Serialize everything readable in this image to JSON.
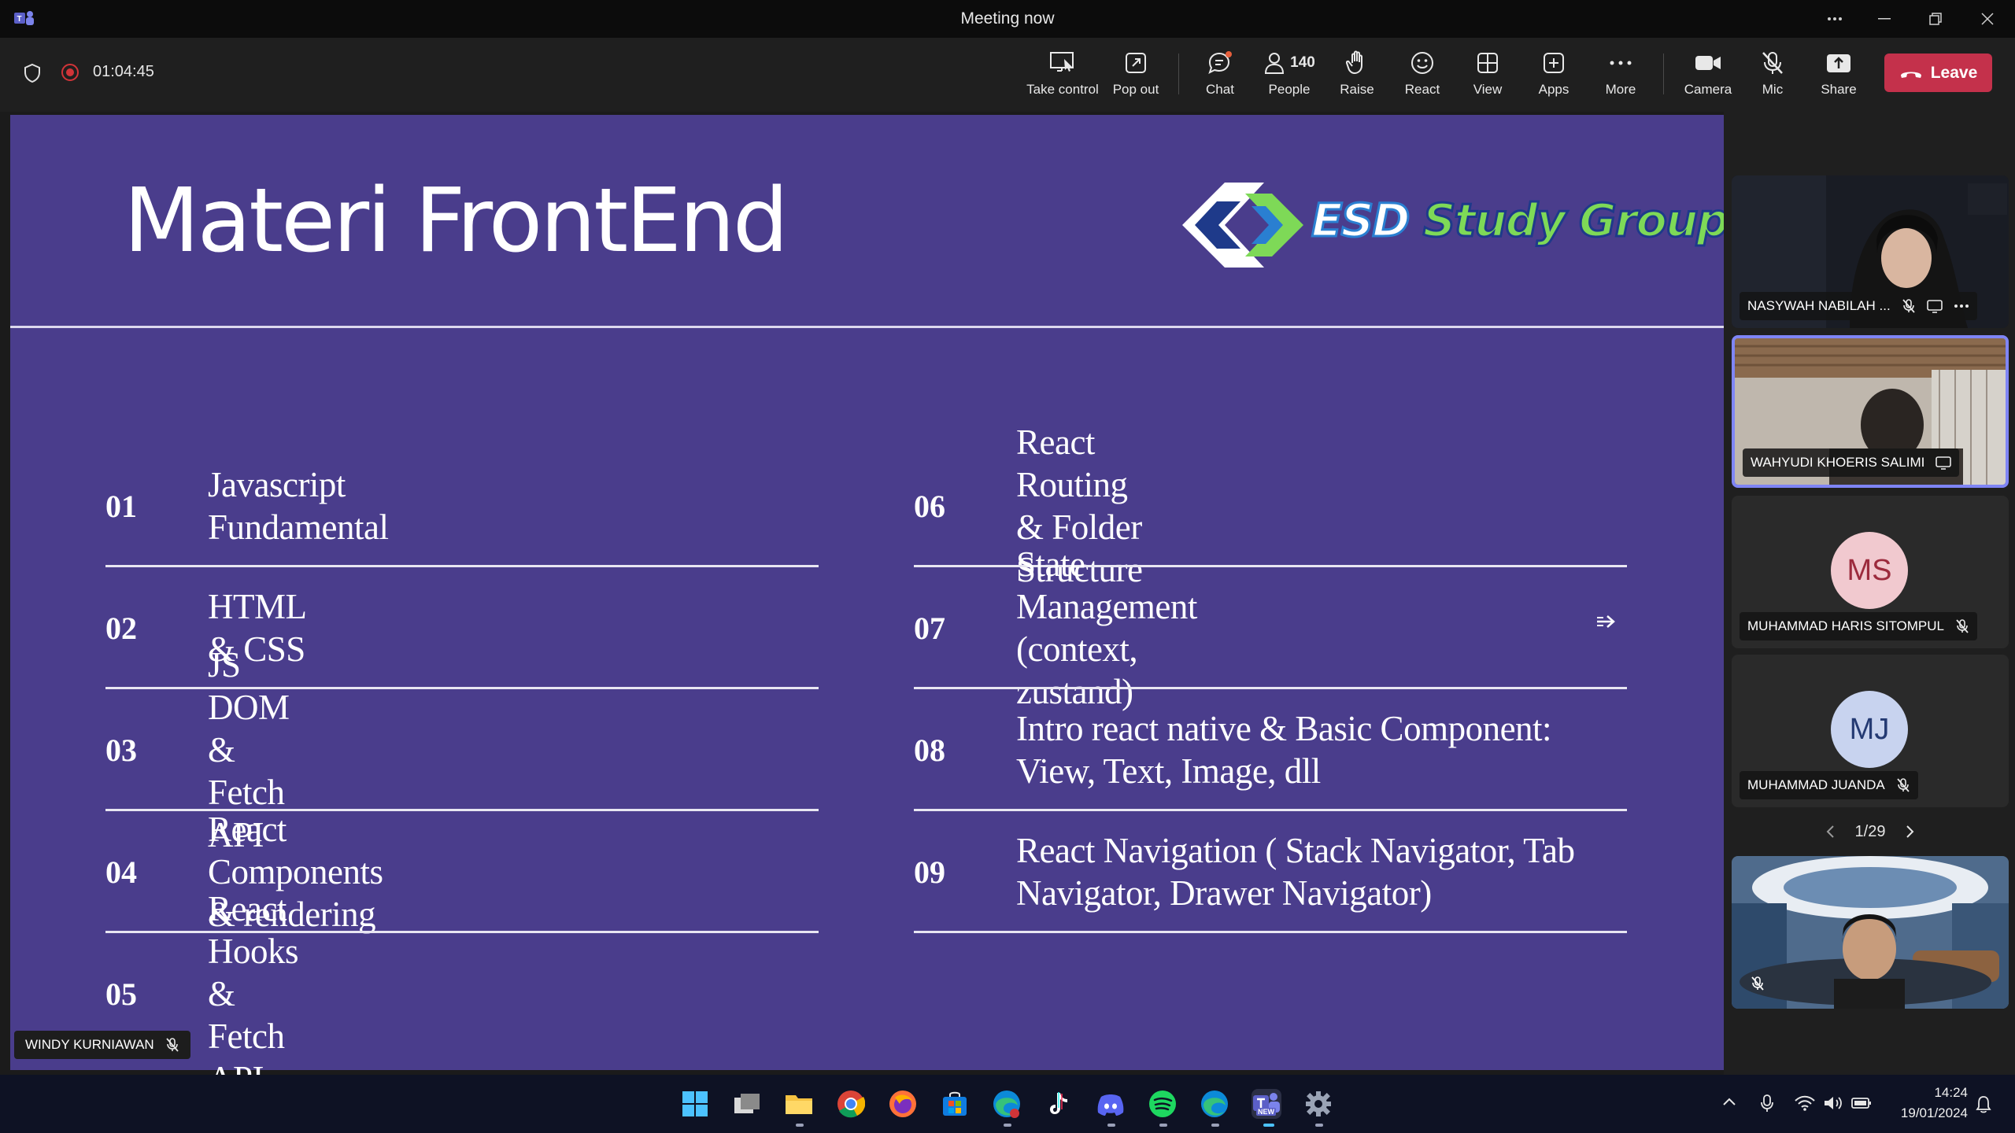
{
  "window": {
    "title": "Meeting now"
  },
  "meeting": {
    "timer": "01:04:45"
  },
  "toolbar": {
    "take_control": "Take control",
    "pop_out": "Pop out",
    "chat": "Chat",
    "people": "People",
    "people_count": "140",
    "raise": "Raise",
    "react": "React",
    "view": "View",
    "apps": "Apps",
    "more": "More",
    "camera": "Camera",
    "mic": "Mic",
    "share": "Share",
    "leave": "Leave",
    "leave_color": "#c4314b"
  },
  "slide": {
    "title": "Materi FrontEnd",
    "logo_text_1": "ESD",
    "logo_text_2": "Study Group",
    "background": "#4a3d8c",
    "topics_left": [
      {
        "num": "01",
        "text": "Javascript Fundamental"
      },
      {
        "num": "02",
        "text": "HTML & CSS"
      },
      {
        "num": "03",
        "text": "JS DOM & Fetch API"
      },
      {
        "num": "04",
        "text": "React Components & rendering"
      },
      {
        "num": "05",
        "text": "React Hooks & Fetch API"
      }
    ],
    "topics_right": [
      {
        "num": "06",
        "text": "React Routing & Folder Structure"
      },
      {
        "num": "07",
        "text": "State Management (context, zustand)"
      },
      {
        "num": "08",
        "text": "Intro react native & Basic Component: View, Text, Image, dll"
      },
      {
        "num": "09",
        "text": "React Navigation ( Stack Navigator, Tab Navigator, Drawer Navigator)"
      }
    ]
  },
  "presenter": {
    "name": "WINDY KURNIAWAN"
  },
  "participants": [
    {
      "name": "NASYWAH NABILAH ..."
    },
    {
      "name": "WAHYUDI KHOERIS SALIMI"
    },
    {
      "name": "MUHAMMAD HARIS SITOMPUL",
      "initials": "MS",
      "avatar_bg": "#f1c9cf",
      "avatar_fg": "#9c2b3d"
    },
    {
      "name": "MUHAMMAD JUANDA",
      "initials": "MJ",
      "avatar_bg": "#c8d3ef",
      "avatar_fg": "#243a73"
    }
  ],
  "pager": {
    "text": "1/29"
  },
  "taskbar": {
    "time": "14:24",
    "date": "19/01/2024",
    "teams_badge": "NEW"
  }
}
